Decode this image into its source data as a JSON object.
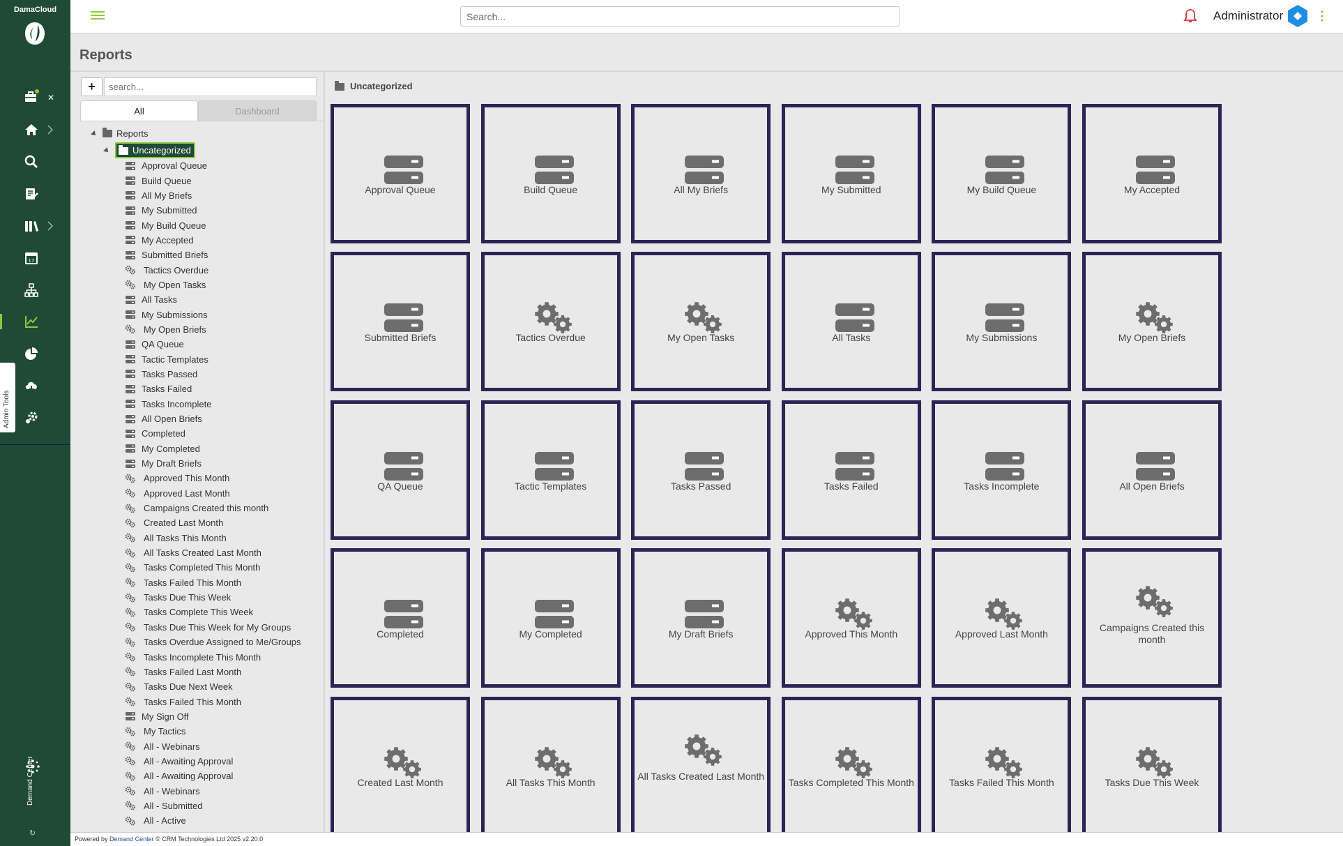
{
  "brand": {
    "name": "DamaCloud"
  },
  "topbar": {
    "search_placeholder": "Search...",
    "user_name": "Administrator"
  },
  "admin_tools": {
    "label": "Admin Tools"
  },
  "demand_center_logo": {
    "text": "Demand Center"
  },
  "page": {
    "title": "Reports"
  },
  "left_panel": {
    "add_label": "+",
    "search_placeholder": "search...",
    "tabs": [
      {
        "label": "All",
        "active": true
      },
      {
        "label": "Dashboard",
        "active": false
      }
    ],
    "root_label": "Reports",
    "folder_label": "Uncategorized",
    "items": [
      {
        "label": "Approval Queue",
        "icon": "list-icon"
      },
      {
        "label": "Build Queue",
        "icon": "list-icon"
      },
      {
        "label": "All My Briefs",
        "icon": "list-icon"
      },
      {
        "label": "My Submitted",
        "icon": "list-icon"
      },
      {
        "label": "My Build Queue",
        "icon": "list-icon"
      },
      {
        "label": "My Accepted",
        "icon": "list-icon"
      },
      {
        "label": "Submitted Briefs",
        "icon": "list-icon"
      },
      {
        "label": "Tactics Overdue",
        "icon": "gears-icon"
      },
      {
        "label": "My Open Tasks",
        "icon": "gears-icon"
      },
      {
        "label": "All Tasks",
        "icon": "list-icon"
      },
      {
        "label": "My Submissions",
        "icon": "list-icon"
      },
      {
        "label": "My Open Briefs",
        "icon": "gears-icon"
      },
      {
        "label": "QA Queue",
        "icon": "list-icon"
      },
      {
        "label": "Tactic Templates",
        "icon": "list-icon"
      },
      {
        "label": "Tasks Passed",
        "icon": "list-icon"
      },
      {
        "label": "Tasks Failed",
        "icon": "list-icon"
      },
      {
        "label": "Tasks Incomplete",
        "icon": "list-icon"
      },
      {
        "label": "All Open Briefs",
        "icon": "list-icon"
      },
      {
        "label": "Completed",
        "icon": "list-icon"
      },
      {
        "label": "My Completed",
        "icon": "list-icon"
      },
      {
        "label": "My Draft Briefs",
        "icon": "list-icon"
      },
      {
        "label": "Approved This Month",
        "icon": "gears-icon"
      },
      {
        "label": "Approved Last Month",
        "icon": "gears-icon"
      },
      {
        "label": "Campaigns Created this month",
        "icon": "gears-icon"
      },
      {
        "label": "Created Last Month",
        "icon": "gears-icon"
      },
      {
        "label": "All Tasks This Month",
        "icon": "gears-icon"
      },
      {
        "label": "All Tasks Created Last Month",
        "icon": "gears-icon"
      },
      {
        "label": "Tasks Completed This Month",
        "icon": "gears-icon"
      },
      {
        "label": "Tasks Failed This Month",
        "icon": "gears-icon"
      },
      {
        "label": "Tasks Due This Week",
        "icon": "gears-icon"
      },
      {
        "label": "Tasks Complete This Week",
        "icon": "gears-icon"
      },
      {
        "label": "Tasks Due This Week for My Groups",
        "icon": "gears-icon"
      },
      {
        "label": "Tasks Overdue Assigned to Me/Groups",
        "icon": "gears-icon"
      },
      {
        "label": "Tasks Incomplete This Month",
        "icon": "gears-icon"
      },
      {
        "label": "Tasks Failed Last Month",
        "icon": "gears-icon"
      },
      {
        "label": "Tasks Due Next Week",
        "icon": "gears-icon"
      },
      {
        "label": "Tasks Failed This Month",
        "icon": "gears-icon"
      },
      {
        "label": "My Sign Off",
        "icon": "list-icon"
      },
      {
        "label": "My Tactics",
        "icon": "gears-icon"
      },
      {
        "label": "All - Webinars",
        "icon": "gears-icon"
      },
      {
        "label": "All - Awaiting Approval",
        "icon": "gears-icon"
      },
      {
        "label": "All - Awaiting Approval",
        "icon": "gears-icon"
      },
      {
        "label": "All - Webinars",
        "icon": "gears-icon"
      },
      {
        "label": "All - Submitted",
        "icon": "gears-icon"
      },
      {
        "label": "All - Active",
        "icon": "gears-icon"
      }
    ]
  },
  "right_panel": {
    "heading": "Uncategorized",
    "cards": [
      {
        "label": "Approval Queue",
        "icon": "list-icon"
      },
      {
        "label": "Build Queue",
        "icon": "list-icon"
      },
      {
        "label": "All My Briefs",
        "icon": "list-icon"
      },
      {
        "label": "My Submitted",
        "icon": "list-icon"
      },
      {
        "label": "My Build Queue",
        "icon": "list-icon"
      },
      {
        "label": "My Accepted",
        "icon": "list-icon"
      },
      {
        "label": "Submitted Briefs",
        "icon": "list-icon"
      },
      {
        "label": "Tactics Overdue",
        "icon": "gears-icon"
      },
      {
        "label": "My Open Tasks",
        "icon": "gears-icon"
      },
      {
        "label": "All Tasks",
        "icon": "list-icon"
      },
      {
        "label": "My Submissions",
        "icon": "list-icon"
      },
      {
        "label": "My Open Briefs",
        "icon": "gears-icon"
      },
      {
        "label": "QA Queue",
        "icon": "list-icon"
      },
      {
        "label": "Tactic Templates",
        "icon": "list-icon"
      },
      {
        "label": "Tasks Passed",
        "icon": "list-icon"
      },
      {
        "label": "Tasks Failed",
        "icon": "list-icon"
      },
      {
        "label": "Tasks Incomplete",
        "icon": "list-icon"
      },
      {
        "label": "All Open Briefs",
        "icon": "list-icon"
      },
      {
        "label": "Completed",
        "icon": "list-icon"
      },
      {
        "label": "My Completed",
        "icon": "list-icon"
      },
      {
        "label": "My Draft Briefs",
        "icon": "list-icon"
      },
      {
        "label": "Approved This Month",
        "icon": "gears-icon"
      },
      {
        "label": "Approved Last Month",
        "icon": "gears-icon"
      },
      {
        "label": "Campaigns Created this month",
        "icon": "gears-icon"
      },
      {
        "label": "Created Last Month",
        "icon": "gears-icon"
      },
      {
        "label": "All Tasks This Month",
        "icon": "gears-icon"
      },
      {
        "label": "All Tasks Created Last Month",
        "icon": "gears-icon"
      },
      {
        "label": "Tasks Completed This Month",
        "icon": "gears-icon"
      },
      {
        "label": "Tasks Failed This Month",
        "icon": "gears-icon"
      },
      {
        "label": "Tasks Due This Week",
        "icon": "gears-icon"
      }
    ]
  },
  "footer": {
    "prefix": "Powered by",
    "link": "Demand Center",
    "suffix": "© CRM Technologies Ltd 2025 v2.20.0"
  },
  "colors": {
    "rail": "#1f4a36",
    "accent": "#8fc83d",
    "card_border": "#2b2556",
    "bell": "#d0343a",
    "avatar": "#1b8fe0"
  }
}
